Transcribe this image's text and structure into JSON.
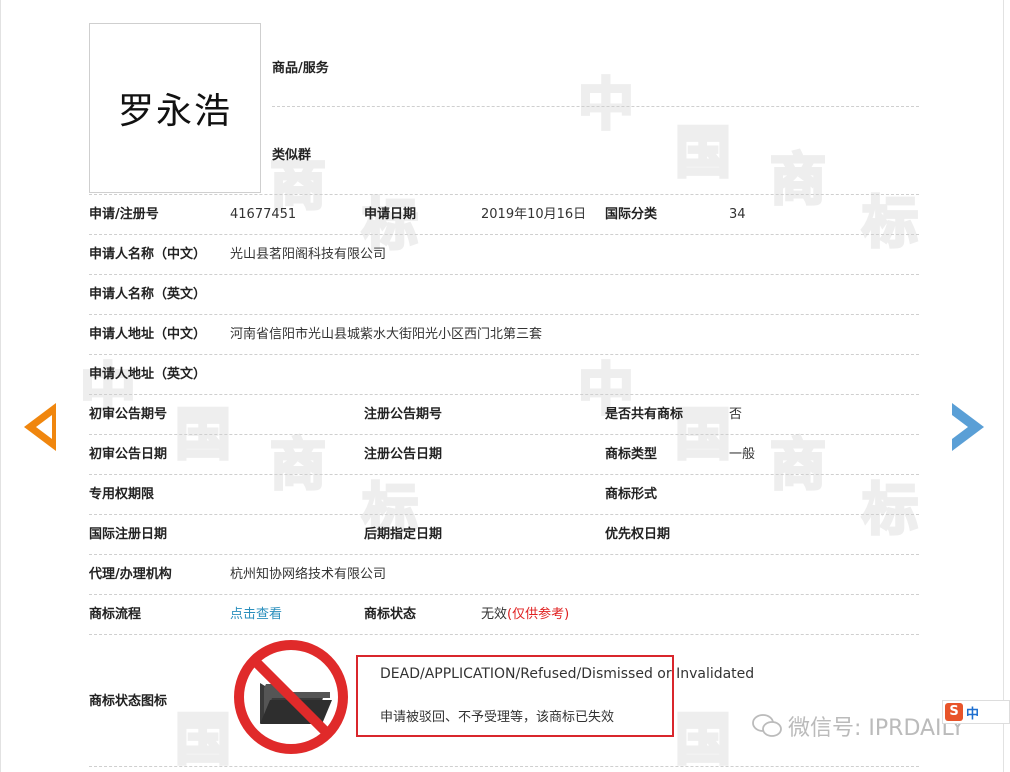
{
  "mark": {
    "name": "罗永浩"
  },
  "top_labels": {
    "goods_services": "商品/服务",
    "similar_group": "类似群"
  },
  "rows": [
    {
      "cells": [
        {
          "label": "申请/注册号",
          "value": "41677451"
        },
        {
          "label": "申请日期",
          "value": "2019年10月16日"
        },
        {
          "label": "国际分类",
          "value": "34"
        }
      ]
    },
    {
      "cells": [
        {
          "label": "申请人名称（中文）",
          "value": "光山县茗阳阁科技有限公司"
        }
      ]
    },
    {
      "cells": [
        {
          "label": "申请人名称（英文）",
          "value": ""
        }
      ]
    },
    {
      "cells": [
        {
          "label": "申请人地址（中文）",
          "value": "河南省信阳市光山县城紫水大街阳光小区西门北第三套"
        }
      ]
    },
    {
      "cells": [
        {
          "label": "申请人地址（英文）",
          "value": ""
        }
      ]
    },
    {
      "cells": [
        {
          "label": "初审公告期号",
          "value": ""
        },
        {
          "label": "注册公告期号",
          "value": ""
        },
        {
          "label": "是否共有商标",
          "value": "否"
        }
      ]
    },
    {
      "cells": [
        {
          "label": "初审公告日期",
          "value": ""
        },
        {
          "label": "注册公告日期",
          "value": ""
        },
        {
          "label": "商标类型",
          "value": "一般"
        }
      ]
    },
    {
      "cells": [
        {
          "label": "专用权期限",
          "value": ""
        },
        {
          "label": "",
          "value": ""
        },
        {
          "label": "商标形式",
          "value": ""
        }
      ]
    },
    {
      "cells": [
        {
          "label": "国际注册日期",
          "value": ""
        },
        {
          "label": "后期指定日期",
          "value": ""
        },
        {
          "label": "优先权日期",
          "value": ""
        }
      ]
    },
    {
      "cells": [
        {
          "label": "代理/办理机构",
          "value": "杭州知协网络技术有限公司"
        }
      ]
    },
    {
      "cells": [
        {
          "label": "商标流程",
          "value": "点击查看"
        },
        {
          "label": "商标状态",
          "value": "无效",
          "note": "(仅供参考)"
        }
      ]
    }
  ],
  "status": {
    "label": "商标状态图标",
    "english": "DEAD/APPLICATION/Refused/Dismissed or Invalidated",
    "chinese": "申请被驳回、不予受理等，该商标已失效",
    "icon": "no-folder-icon"
  },
  "watermark": {
    "chars": [
      "中",
      "国",
      "商",
      "标"
    ]
  },
  "ime": {
    "logo": "S",
    "text": "中"
  },
  "wechat": {
    "text": "微信号: IPRDAILY",
    "icon": "wechat-icon"
  },
  "colors": {
    "arrow_left": "#f0860e",
    "arrow_right": "#5a9fd6",
    "link": "#2a8fbd",
    "alert": "#d9262c"
  }
}
